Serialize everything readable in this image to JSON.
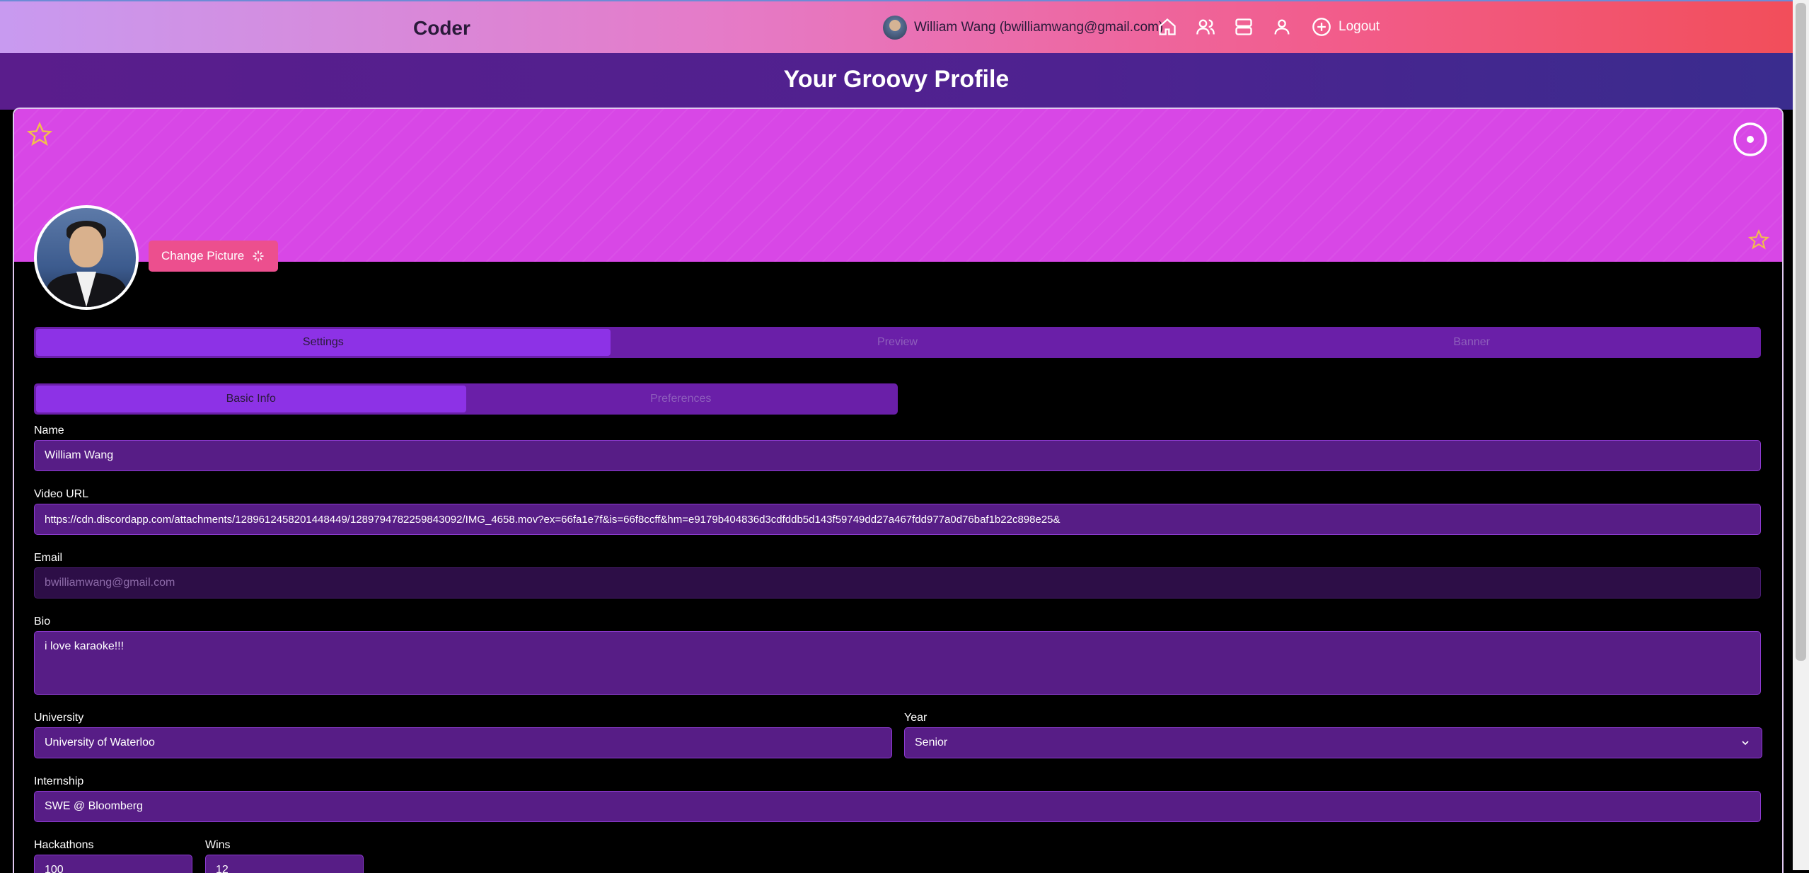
{
  "app": {
    "brand": "Coder"
  },
  "header": {
    "user_display": "William Wang (bwilliamwang@gmail.com)",
    "logout_label": "Logout"
  },
  "page": {
    "title": "Your Groovy Profile"
  },
  "profile": {
    "change_picture_label": "Change Picture"
  },
  "tabs": {
    "main": [
      "Settings",
      "Preview",
      "Banner"
    ],
    "sub": [
      "Basic Info",
      "Preferences"
    ]
  },
  "form": {
    "name_label": "Name",
    "name_value": "William Wang",
    "video_label": "Video URL",
    "video_value": "https://cdn.discordapp.com/attachments/1289612458201448449/1289794782259843092/IMG_4658.mov?ex=66fa1e7f&is=66f8ccff&hm=e9179b404836d3cdfddb5d143f59749dd27a467fdd977a0d76baf1b22c898e25&",
    "email_label": "Email",
    "email_value": "bwilliamwang@gmail.com",
    "bio_label": "Bio",
    "bio_value": "i love karaoke!!!",
    "university_label": "University",
    "university_value": "University of Waterloo",
    "year_label": "Year",
    "year_value": "Senior",
    "internship_label": "Internship",
    "internship_value": "SWE @ Bloomberg",
    "hackathons_label": "Hackathons",
    "hackathons_value": "100",
    "wins_label": "Wins",
    "wins_value": "12"
  },
  "icons": [
    "home-icon",
    "users-icon",
    "server-icon",
    "profile-icon",
    "plus-circle-icon",
    "star-icon",
    "disc-icon",
    "sparkle-icon",
    "chevron-down-icon"
  ],
  "colors": {
    "banner": "#d847e6",
    "accent": "#8d32e6",
    "button": "#ec4f8e"
  }
}
